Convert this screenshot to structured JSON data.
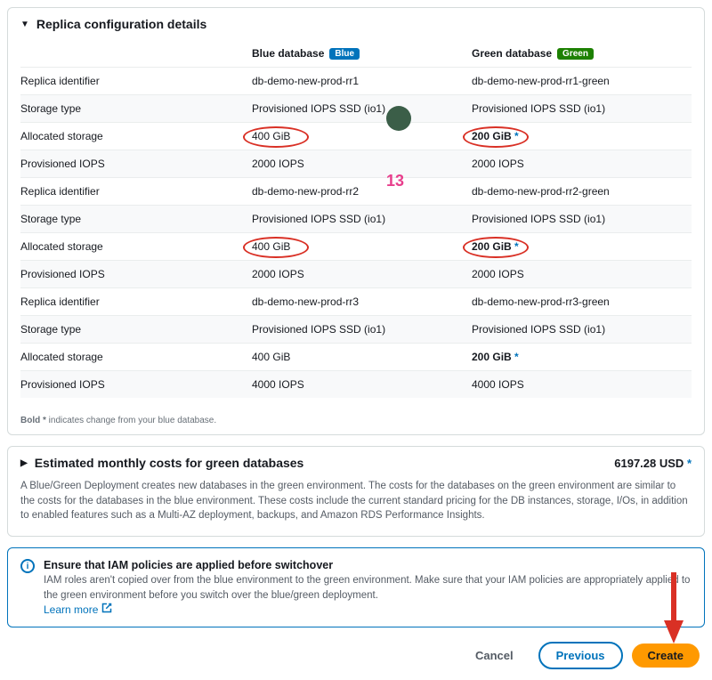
{
  "header": {
    "replica_title": "Replica configuration details",
    "col_label_blank": "",
    "col_blue_label": "Blue database",
    "col_blue_badge": "Blue",
    "col_green_label": "Green database",
    "col_green_badge": "Green"
  },
  "rows": [
    {
      "label": "Replica identifier",
      "blue": "db-demo-new-prod-rr1",
      "green": "db-demo-new-prod-rr1-green",
      "shade": false,
      "bold_green": false,
      "oval": false
    },
    {
      "label": "Storage type",
      "blue": "Provisioned IOPS SSD (io1)",
      "green": "Provisioned IOPS SSD (io1)",
      "shade": true,
      "bold_green": false,
      "oval": false
    },
    {
      "label": "Allocated storage",
      "blue": "400 GiB",
      "green": "200 GiB",
      "green_marker": "*",
      "shade": false,
      "bold_green": true,
      "oval": true
    },
    {
      "label": "Provisioned IOPS",
      "blue": "2000 IOPS",
      "green": "2000 IOPS",
      "shade": true,
      "bold_green": false,
      "oval": false
    },
    {
      "label": "Replica identifier",
      "blue": "db-demo-new-prod-rr2",
      "green": "db-demo-new-prod-rr2-green",
      "shade": false,
      "bold_green": false,
      "oval": false
    },
    {
      "label": "Storage type",
      "blue": "Provisioned IOPS SSD (io1)",
      "green": "Provisioned IOPS SSD (io1)",
      "shade": true,
      "bold_green": false,
      "oval": false
    },
    {
      "label": "Allocated storage",
      "blue": "400 GiB",
      "green": "200 GiB",
      "green_marker": "*",
      "shade": false,
      "bold_green": true,
      "oval": true
    },
    {
      "label": "Provisioned IOPS",
      "blue": "2000 IOPS",
      "green": "2000 IOPS",
      "shade": true,
      "bold_green": false,
      "oval": false
    },
    {
      "label": "Replica identifier",
      "blue": "db-demo-new-prod-rr3",
      "green": "db-demo-new-prod-rr3-green",
      "shade": false,
      "bold_green": false,
      "oval": false
    },
    {
      "label": "Storage type",
      "blue": "Provisioned IOPS SSD (io1)",
      "green": "Provisioned IOPS SSD (io1)",
      "shade": true,
      "bold_green": false,
      "oval": false
    },
    {
      "label": "Allocated storage",
      "blue": "400 GiB",
      "green": "200 GiB",
      "green_marker": "*",
      "shade": false,
      "bold_green": true,
      "oval": false
    },
    {
      "label": "Provisioned IOPS",
      "blue": "4000 IOPS",
      "green": "4000 IOPS",
      "shade": true,
      "bold_green": false,
      "oval": false
    }
  ],
  "hint_prefix": "Bold *",
  "hint": " indicates change from your blue database.",
  "cost_section": {
    "title": "Estimated monthly costs for green databases",
    "amount": "6197.28 USD",
    "amount_marker": "*",
    "desc": "A Blue/Green Deployment creates new databases in the green environment. The costs for the databases on the green environment are similar to the costs for the databases in the blue environment. These costs include the current standard pricing for the DB instances, storage, I/Os, in addition to enabled features such as a Multi-AZ deployment, backups, and Amazon RDS Performance Insights."
  },
  "info_box": {
    "title": "Ensure that IAM policies are applied before switchover",
    "desc": "IAM roles aren't copied over from the blue environment to the green environment. Make sure that your IAM policies are appropriately applied to the green environment before you switch over the blue/green deployment.",
    "link": "Learn more"
  },
  "footer": {
    "cancel": "Cancel",
    "previous": "Previous",
    "create": "Create"
  },
  "annot_13": "13"
}
